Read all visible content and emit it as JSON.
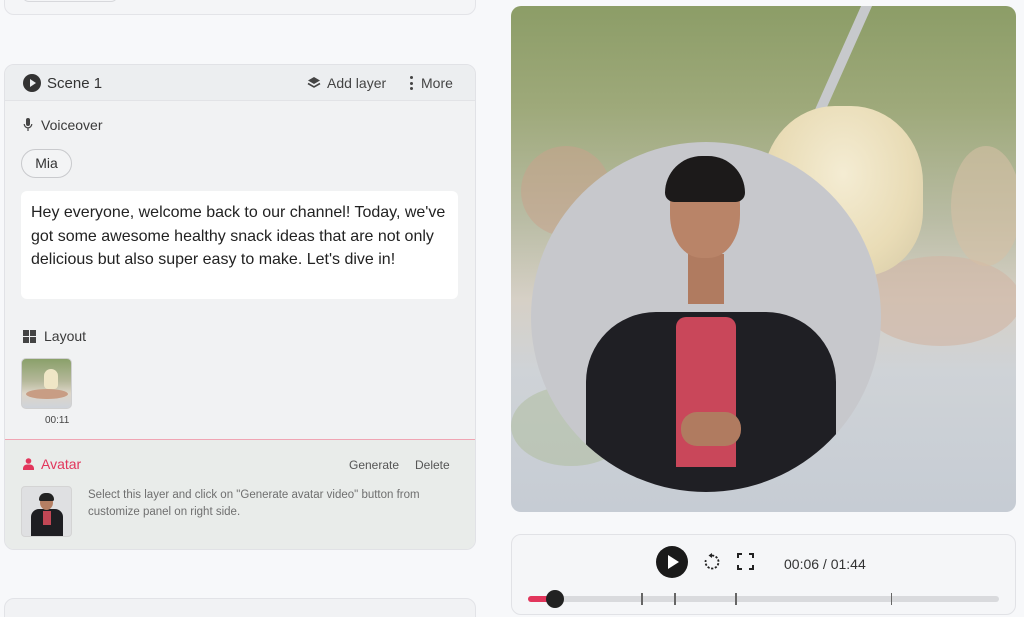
{
  "scene": {
    "title": "Scene 1",
    "add_layer_label": "Add layer",
    "more_label": "More"
  },
  "voiceover": {
    "label": "Voiceover",
    "voice_name": "Mia",
    "script": "Hey everyone, welcome back to our channel! Today, we've got some awesome healthy snack ideas that are not only delicious but also super easy to make. Let's dive in!"
  },
  "layout": {
    "label": "Layout",
    "thumbnail_duration": "00:11"
  },
  "avatar": {
    "label": "Avatar",
    "generate_label": "Generate",
    "delete_label": "Delete",
    "description": "Select this layer and click on \"Generate avatar video\" button from customize panel on right side."
  },
  "player": {
    "time": "00:06 / 01:44",
    "progress": 0.057,
    "markers": [
      0.057,
      0.24,
      0.31,
      0.44,
      0.77
    ]
  },
  "colors": {
    "accent": "#e2365c",
    "dark": "#1a1a1a"
  },
  "icons": [
    "play-icon",
    "layers-icon",
    "kebab-icon",
    "mic-icon",
    "layout-grid-icon",
    "person-icon",
    "replay-icon",
    "fullscreen-icon"
  ]
}
